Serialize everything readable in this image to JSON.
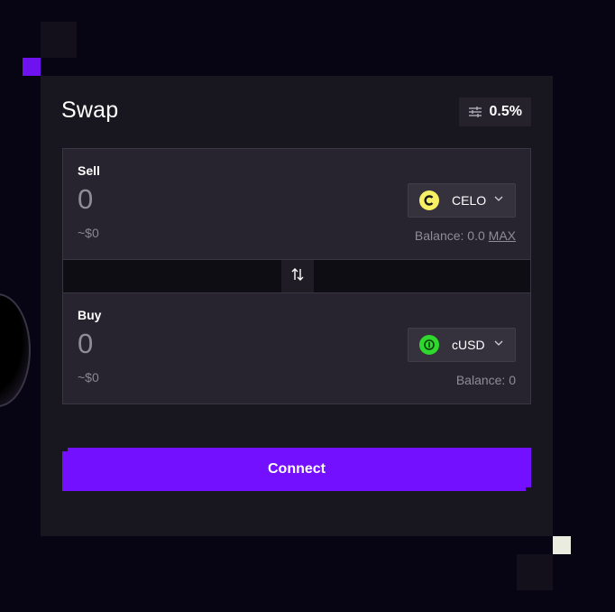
{
  "swap": {
    "title": "Swap",
    "slippage": "0.5%",
    "sell": {
      "label": "Sell",
      "amount_placeholder": "0",
      "fiat": "~$0",
      "token": "CELO",
      "token_icon": "celo-token-icon",
      "balance_text": "Balance: 0.0",
      "max_label": "MAX"
    },
    "buy": {
      "label": "Buy",
      "amount_placeholder": "0",
      "fiat": "~$0",
      "token": "cUSD",
      "token_icon": "cusd-token-icon",
      "balance_text": "Balance: 0"
    },
    "connect_label": "Connect"
  },
  "icons": {
    "settings": "sliders-icon",
    "flip": "swap-arrows-icon",
    "chevron": "chevron-down-icon"
  },
  "colors": {
    "accent": "#7310ff",
    "background": "#070414",
    "card": "#18161e",
    "panel": "#27232f",
    "celo": "#f7f064",
    "cusd": "#2fd82c"
  }
}
